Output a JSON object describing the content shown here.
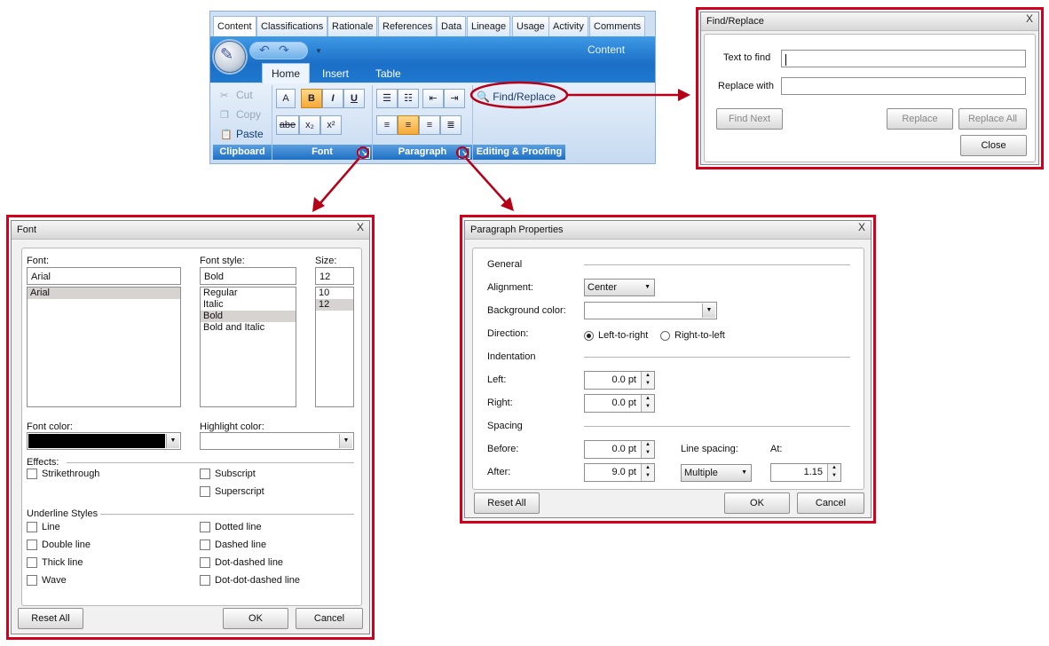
{
  "ribbon": {
    "context_tabs": [
      "Content",
      "Classifications",
      "Rationale",
      "References",
      "Data",
      "Lineage",
      "Usage",
      "Activity",
      "Comments"
    ],
    "context_label": "Content",
    "ribbon_tabs": [
      "Home",
      "Insert",
      "Table"
    ],
    "clipboard": {
      "cut": "Cut",
      "copy": "Copy",
      "paste": "Paste",
      "caption": "Clipboard"
    },
    "font_group": {
      "caption": "Font",
      "bold": "B",
      "italic": "I",
      "underline": "U",
      "strike": "abe",
      "subscript": "x₂",
      "superscript": "x²"
    },
    "paragraph_group": {
      "caption": "Paragraph"
    },
    "editing_group": {
      "caption": "Editing & Proofing",
      "find_replace": "Find/Replace"
    }
  },
  "find_replace": {
    "title": "Find/Replace",
    "close_x": "X",
    "text_to_find_label": "Text to find",
    "replace_with_label": "Replace with",
    "find_next": "Find Next",
    "replace": "Replace",
    "replace_all": "Replace All",
    "close": "Close"
  },
  "font_dialog": {
    "title": "Font",
    "close_x": "X",
    "font_label": "Font:",
    "font_value": "Arial",
    "font_list": [
      "Arial"
    ],
    "style_label": "Font style:",
    "style_value": "Bold",
    "style_list": [
      "Regular",
      "Italic",
      "Bold",
      "Bold and Italic"
    ],
    "style_selected": "Bold",
    "size_label": "Size:",
    "size_value": "12",
    "size_list": [
      "10",
      "12"
    ],
    "size_selected": "12",
    "font_color_label": "Font color:",
    "highlight_color_label": "Highlight color:",
    "font_color": "#000000",
    "effects_label": "Effects:",
    "effects": [
      "Strikethrough",
      "Subscript",
      "Superscript"
    ],
    "underline_label": "Underline Styles",
    "underline_left": [
      "Line",
      "Double line",
      "Thick line",
      "Wave"
    ],
    "underline_right": [
      "Dotted line",
      "Dashed line",
      "Dot-dashed line",
      "Dot-dot-dashed line"
    ],
    "reset_all": "Reset All",
    "ok": "OK",
    "cancel": "Cancel"
  },
  "paragraph_dialog": {
    "title": "Paragraph Properties",
    "close_x": "X",
    "general": "General",
    "alignment_label": "Alignment:",
    "alignment_value": "Center",
    "background_label": "Background color:",
    "direction_label": "Direction:",
    "ltr": "Left-to-right",
    "rtl": "Right-to-left",
    "indentation": "Indentation",
    "left_label": "Left:",
    "left_value": "0.0 pt",
    "right_label": "Right:",
    "right_value": "0.0 pt",
    "spacing": "Spacing",
    "before_label": "Before:",
    "before_value": "0.0 pt",
    "after_label": "After:",
    "after_value": "9.0 pt",
    "line_spacing_label": "Line spacing:",
    "line_spacing_value": "Multiple",
    "at_label": "At:",
    "at_value": "1.15",
    "reset_all": "Reset All",
    "ok": "OK",
    "cancel": "Cancel"
  },
  "colors": {
    "highlight_frame": "#d2001c",
    "ribbon_blue": "#1f6fc4"
  }
}
